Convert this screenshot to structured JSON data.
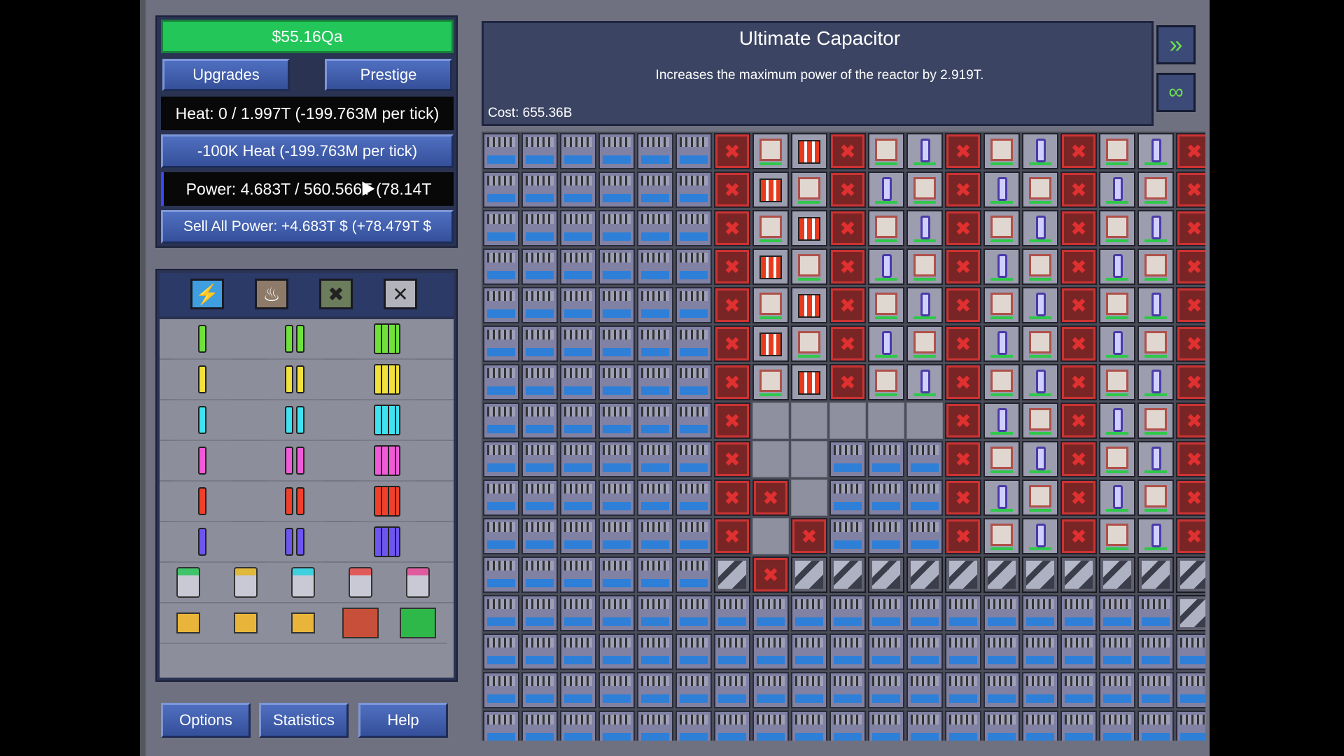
{
  "money": "$55.16Qa",
  "buttons": {
    "upgrades": "Upgrades",
    "prestige": "Prestige",
    "reduce_heat": "-100K Heat (-199.763M per tick)",
    "sell_power": "Sell All Power: +4.683T $ (+78.479T $",
    "options": "Options",
    "statistics": "Statistics",
    "help": "Help"
  },
  "stats": {
    "heat": "Heat: 0 / 1.997T (-199.763M per tick)",
    "power": "Power: 4.683T / 560.566T (78.14T"
  },
  "info": {
    "title": "Ultimate Capacitor",
    "description": "Increases the maximum power of the reactor by 2.919T.",
    "cost": "Cost: 655.36B"
  },
  "part_tabs": [
    "power-tab-icon",
    "heat-tab-icon",
    "exchanger-tab-icon",
    "delete-tab-icon"
  ],
  "part_rows": [
    {
      "type": "rod",
      "color": "#6fe23a"
    },
    {
      "type": "rod",
      "color": "#f2e13a"
    },
    {
      "type": "rod",
      "color": "#3fe2f0"
    },
    {
      "type": "rod",
      "color": "#f05ad8"
    },
    {
      "type": "rod",
      "color": "#f0402a"
    },
    {
      "type": "rod",
      "color": "#6d55f0"
    }
  ],
  "side_buttons": [
    "fast-forward-icon",
    "infinity-icon"
  ],
  "colors": {
    "money_bar": "#22c659",
    "button": "#4f6fc0",
    "panel": "#2a3352"
  }
}
